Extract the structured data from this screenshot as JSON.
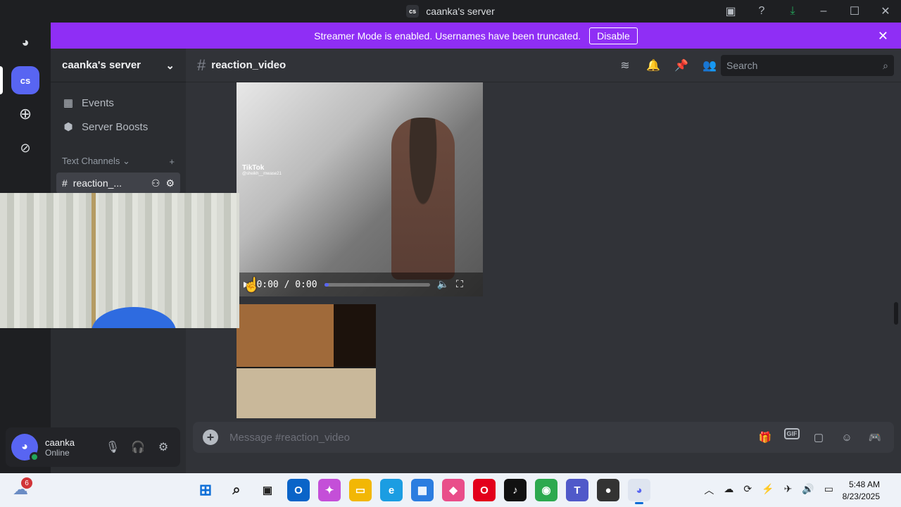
{
  "window": {
    "title": "caanka's server",
    "server_abbrev": "cs"
  },
  "titlebar_icons": [
    "screen-share-icon",
    "help-icon",
    "download-icon",
    "minimize-icon",
    "maximize-icon",
    "close-icon"
  ],
  "guilds": {
    "current": "cs"
  },
  "banner": {
    "text": "Streamer Mode is enabled. Usernames have been truncated.",
    "button": "Disable"
  },
  "sidebar": {
    "server_name": "caanka's server",
    "items": [
      {
        "label": "Events",
        "icon": "calendar-icon"
      },
      {
        "label": "Server Boosts",
        "icon": "boost-icon"
      }
    ],
    "category": "Text Channels",
    "channel": "reaction_..."
  },
  "user": {
    "name": "caanka",
    "status": "Online"
  },
  "channel": {
    "name": "reaction_video"
  },
  "search": {
    "placeholder": "Search"
  },
  "video": {
    "time": "0:00 / 0:00",
    "progress": 0.04,
    "watermark": "TikTok",
    "watermark_user": "@sheikh__mwase21"
  },
  "composer": {
    "placeholder": "Message #reaction_video"
  },
  "taskbar": {
    "notification_count": "6",
    "time": "5:48 AM",
    "date": "8/23/2025"
  },
  "colors": {
    "banner": "#8f2ef5",
    "accent": "#5865f2",
    "online": "#23a55a"
  }
}
